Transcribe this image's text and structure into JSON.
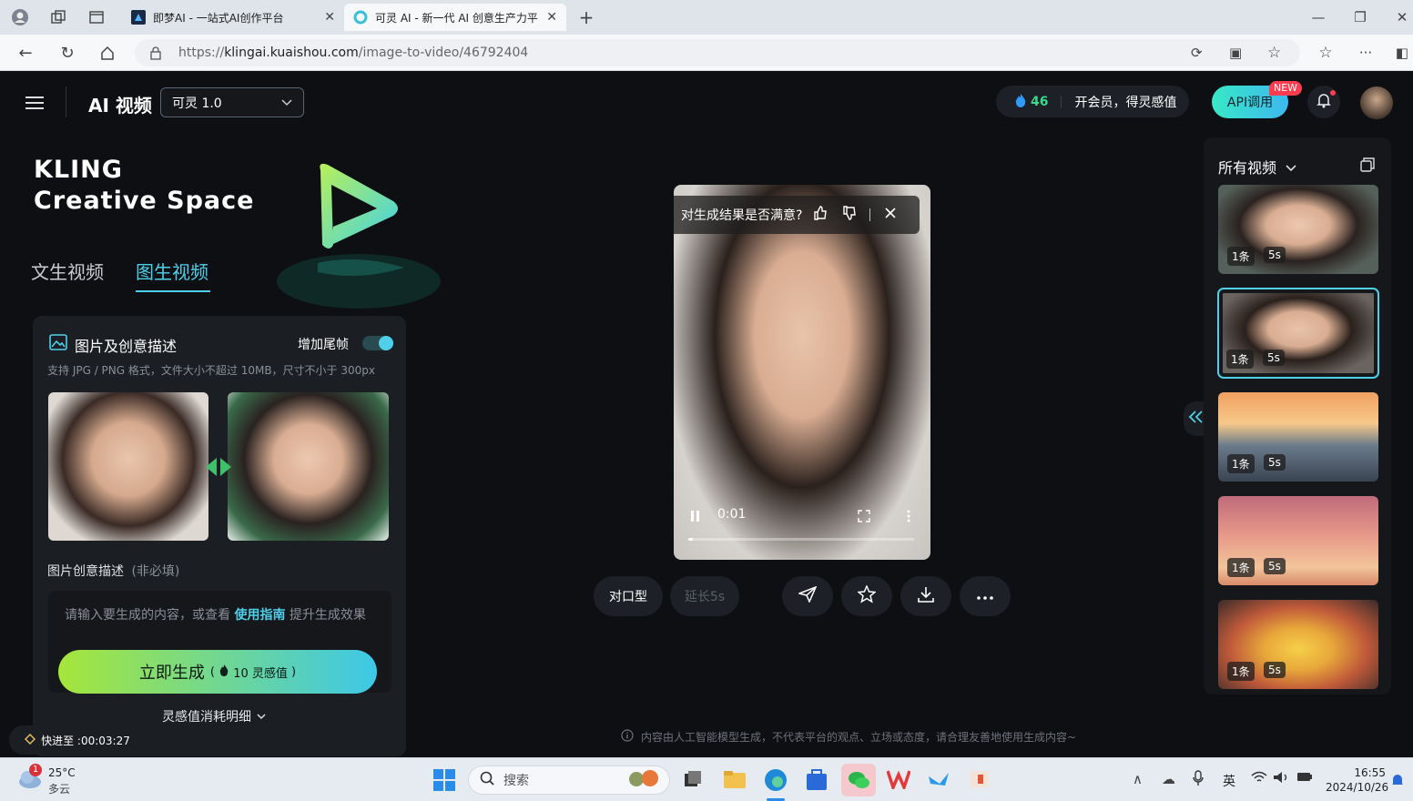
{
  "browser": {
    "tabs": [
      {
        "title": "即梦AI - 一站式AI创作平台"
      },
      {
        "title": "可灵 AI - 新一代 AI 创意生产力平"
      }
    ],
    "url_prefix": "https://",
    "url_host": "klingai.kuaishou.com",
    "url_path": "/image-to-video/46792404"
  },
  "header": {
    "app_title": "AI 视频",
    "model_select": "可灵 1.0",
    "points": "46",
    "member_text": "开会员，得灵感值",
    "api_label": "API调用",
    "new_badge": "NEW"
  },
  "hero": {
    "line1": "KLING",
    "line2": "Creative Space"
  },
  "mode_tabs": [
    {
      "label": "文生视频",
      "active": false
    },
    {
      "label": "图生视频",
      "active": true
    }
  ],
  "panel": {
    "title": "图片及创意描述",
    "toggle_label": "增加尾帧",
    "toggle_on": true,
    "hint": "支持 JPG / PNG 格式，文件大小不超过 10MB，尺寸不小于 300px",
    "desc_label": "图片创意描述",
    "desc_optional": "(非必填)",
    "placeholder_a": "请输入要生成的内容，或查看",
    "placeholder_link": "使用指南",
    "placeholder_b": "提升生成效果",
    "generate_label": "立即生成",
    "generate_cost": "10 灵感值",
    "cost_detail": "灵感值消耗明细"
  },
  "player": {
    "feedback_question": "对生成结果是否满意?",
    "time": "0:01",
    "progress": 0.02
  },
  "actions": {
    "lip_sync": "对口型",
    "extend": "延长5s"
  },
  "footer_note": "内容由人工智能模型生成，不代表平台的观点、立场或态度，请合理友善地使用生成内容~",
  "fast_forward": "快进至 :00:03:27",
  "right_panel": {
    "title": "所有视频",
    "items": [
      {
        "count": "1条",
        "duration": "5s",
        "selected": false
      },
      {
        "count": "1条",
        "duration": "5s",
        "selected": true
      },
      {
        "count": "1条",
        "duration": "5s",
        "selected": false
      },
      {
        "count": "1条",
        "duration": "5s",
        "selected": false
      },
      {
        "count": "1条",
        "duration": "5s",
        "selected": false
      }
    ]
  },
  "taskbar": {
    "weather_temp": "25°C",
    "weather_desc": "多云",
    "weather_badge": "1",
    "search_placeholder": "搜索",
    "ime": "英",
    "time": "16:55",
    "date": "2024/10/26"
  },
  "colors": {
    "accent": "#4fd0ea",
    "generate_start": "#a6e63a",
    "generate_end": "#3dc8e8"
  }
}
